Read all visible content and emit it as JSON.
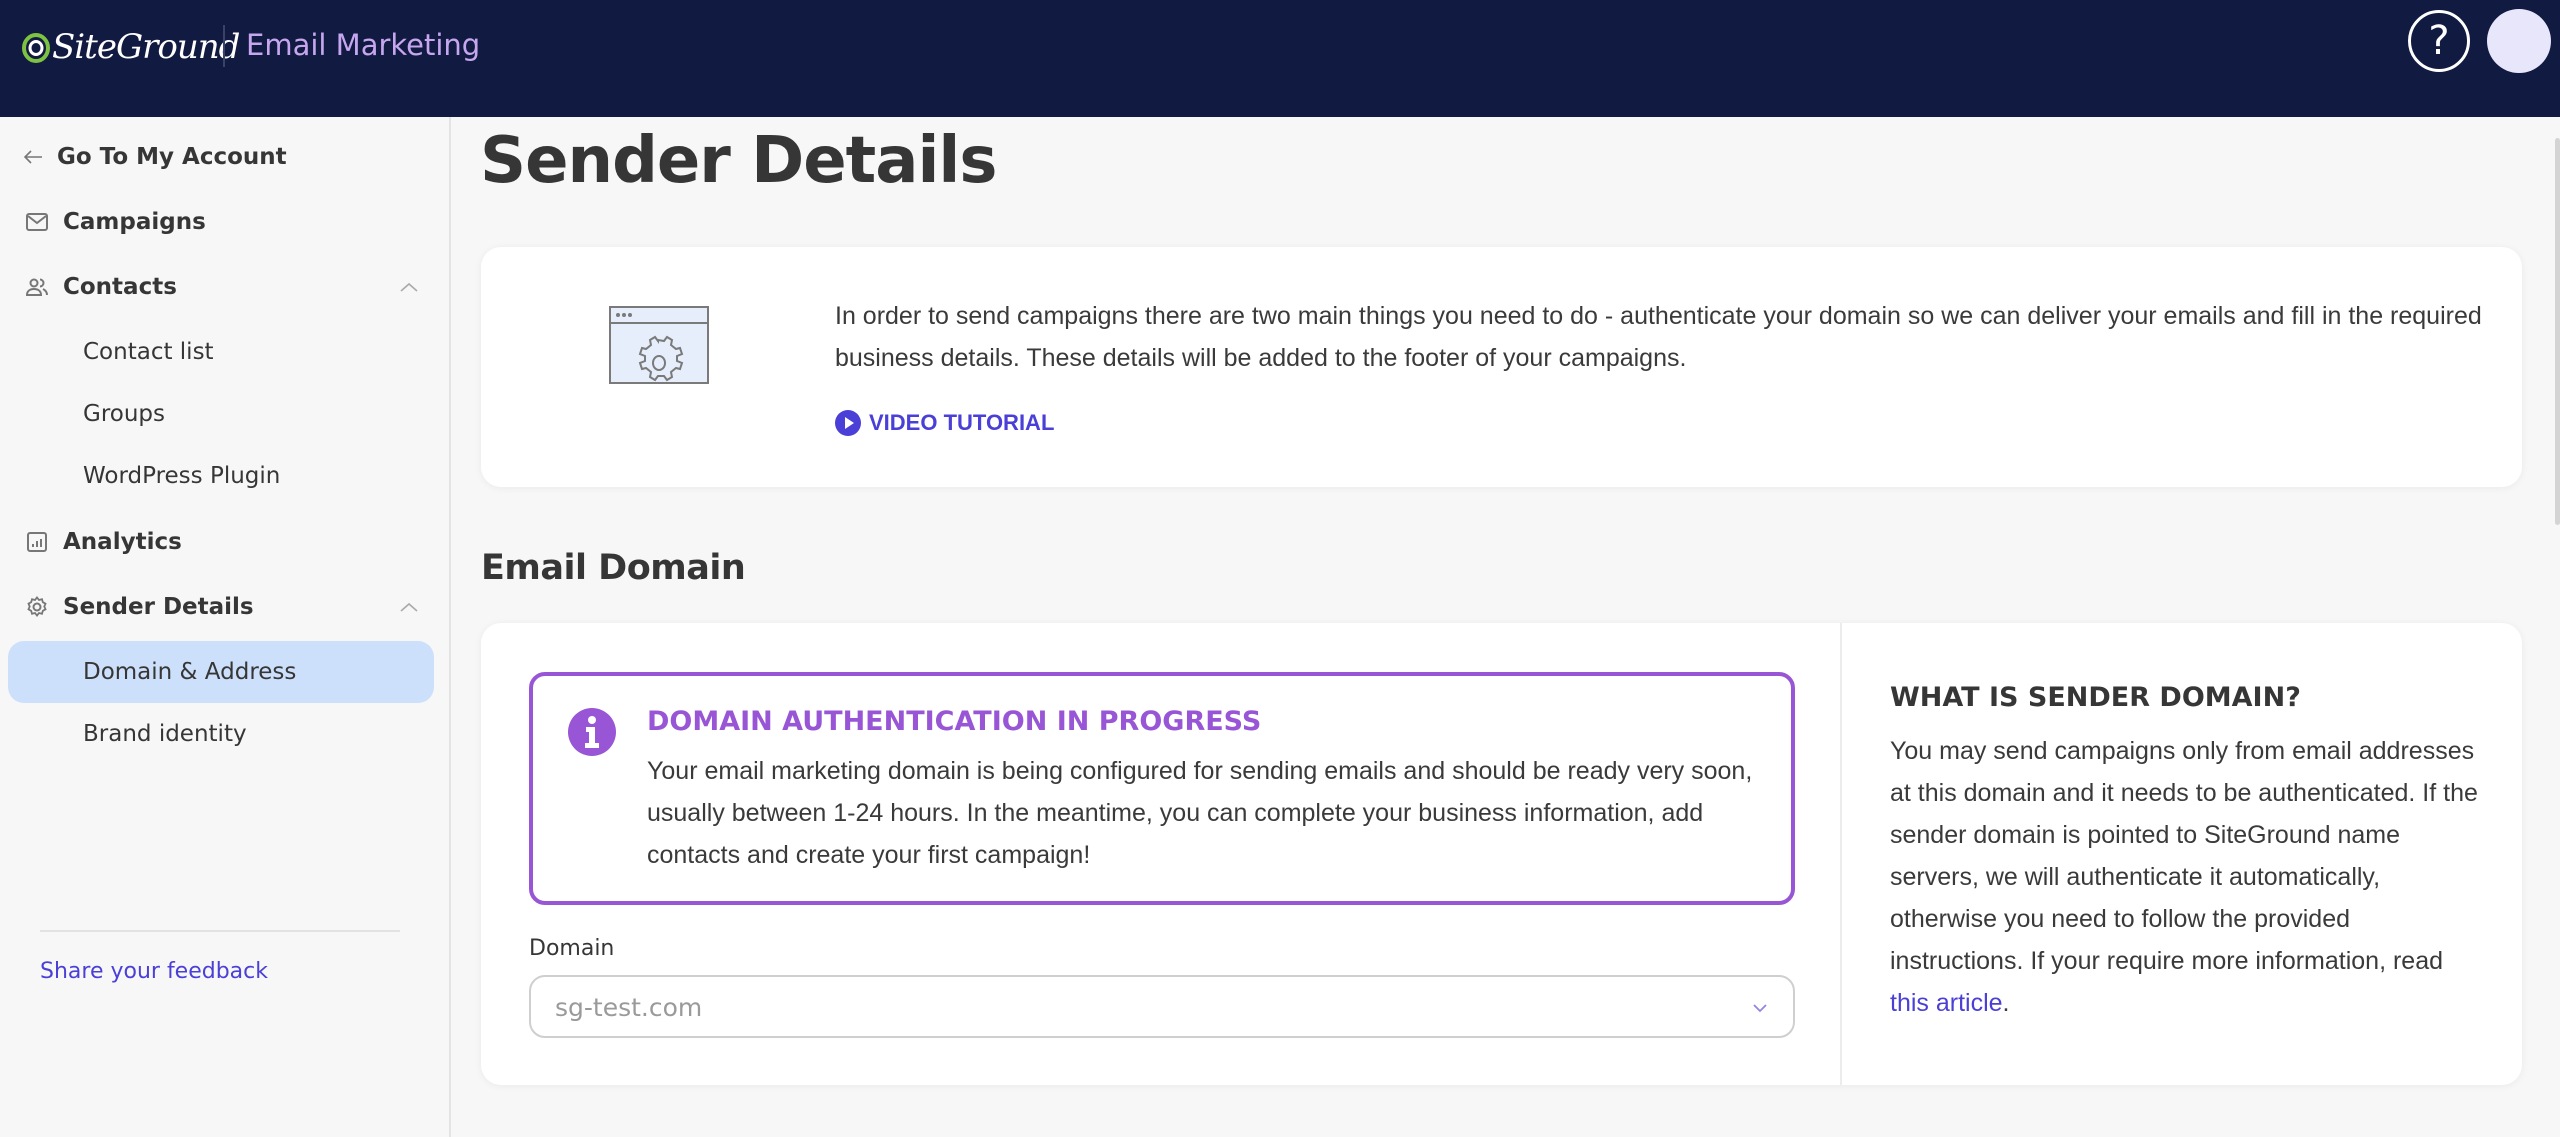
{
  "header": {
    "brand": "SiteGround",
    "app_title": "Email Marketing",
    "help_label": "?",
    "icons": {
      "help": "help-circle-icon",
      "avatar": "user-avatar"
    }
  },
  "sidebar": {
    "back": {
      "label": "Go To My Account",
      "icon": "arrow-left-icon"
    },
    "items": [
      {
        "label": "Campaigns",
        "icon": "envelope-icon"
      },
      {
        "label": "Contacts",
        "icon": "users-icon",
        "expanded": true,
        "children": [
          {
            "label": "Contact list"
          },
          {
            "label": "Groups"
          },
          {
            "label": "WordPress Plugin"
          }
        ]
      },
      {
        "label": "Analytics",
        "icon": "chart-icon"
      },
      {
        "label": "Sender Details",
        "icon": "gear-icon",
        "expanded": true,
        "children": [
          {
            "label": "Domain & Address",
            "active": true
          },
          {
            "label": "Brand identity"
          }
        ]
      }
    ],
    "feedback_link": "Share your feedback"
  },
  "main": {
    "page_title": "Sender Details",
    "intro": {
      "text": "In order to send campaigns there are two main things you need to do - authenticate your domain so we can deliver your emails and fill in the required business details. These details will be added to the footer of your campaigns.",
      "video_link": "VIDEO TUTORIAL"
    },
    "email_domain": {
      "section_title": "Email Domain",
      "alert": {
        "title": "DOMAIN AUTHENTICATION IN PROGRESS",
        "body": "Your email marketing domain is being configured for sending emails and should be ready very soon, usually between 1-24 hours. In the meantime, you can complete your business information, add contacts and create your first campaign!"
      },
      "domain_field": {
        "label": "Domain",
        "value": "sg-test.com"
      },
      "help": {
        "title": "WHAT IS SENDER DOMAIN?",
        "body": "You may send campaigns only from email addresses at this domain and it needs to be authenticated. If the sender domain is pointed to SiteGround name servers, we will authenticate it automatically, otherwise you need to follow the provided instructions. If your require more information, read ",
        "link": "this article",
        "suffix": "."
      }
    }
  },
  "colors": {
    "header_bg": "#111a40",
    "app_title": "#c7a6f0",
    "accent": "#4a3fd6",
    "alert": "#9856d6",
    "active_nav": "#cde0fb"
  }
}
